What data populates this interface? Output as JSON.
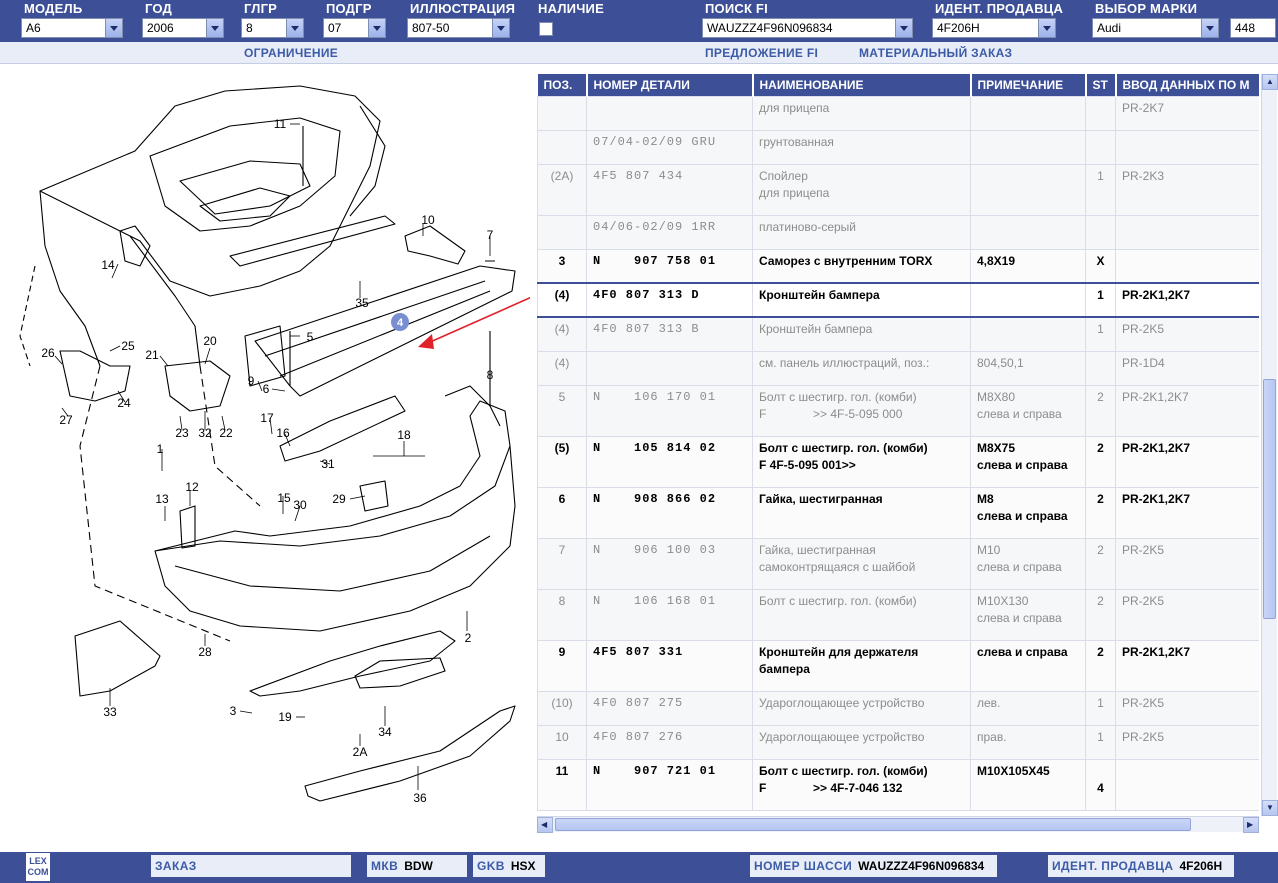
{
  "header": {
    "fields": [
      {
        "label": "МОДЕЛЬ",
        "value": "A6"
      },
      {
        "label": "ГОД",
        "value": "2006"
      },
      {
        "label": "ГЛГР",
        "value": "8"
      },
      {
        "label": "ПОДГР",
        "value": "07"
      },
      {
        "label": "ИЛЛЮСТРАЦИЯ",
        "value": "807-50"
      },
      {
        "label": "НАЛИЧИЕ",
        "value": ""
      },
      {
        "label": "ПОИСК FI",
        "value": "WAUZZZ4F96N096834"
      },
      {
        "label": "ИДЕНТ. ПРОДАВЦА",
        "value": "4F206H"
      },
      {
        "label": "ВЫБОР МАРКИ",
        "value": "Audi"
      }
    ],
    "extra_value": "448"
  },
  "subnav": {
    "restriction": "ОГРАНИЧЕНИЕ",
    "offer_fi": "ПРЕДЛОЖЕНИЕ FI",
    "material_order": "МАТЕРИАЛЬНЫЙ ЗАКАЗ"
  },
  "diagram": {
    "highlighted_callout": "4",
    "callouts": [
      "11",
      "10",
      "7",
      "14",
      "35",
      "5",
      "26",
      "25",
      "21",
      "20",
      "9",
      "6",
      "8",
      "24",
      "27",
      "23",
      "32",
      "22",
      "17",
      "16",
      "31",
      "18",
      "1",
      "12",
      "30",
      "13",
      "29",
      "15",
      "2",
      "28",
      "33",
      "3",
      "19",
      "34",
      "2A",
      "36"
    ]
  },
  "table": {
    "columns": [
      "ПОЗ.",
      "НОМЕР ДЕТАЛИ",
      "НАИМЕНОВАНИЕ",
      "ПРИМЕЧАНИЕ",
      "ST",
      "ВВОД ДАННЫХ ПО М"
    ],
    "rows": [
      {
        "style": "dim",
        "pos": "",
        "num": "",
        "name": "для прицепа",
        "note": "",
        "st": "",
        "data": "PR-2K7"
      },
      {
        "style": "dim",
        "pos": "",
        "num": "07/04-02/09 GRU",
        "name": "грунтованная",
        "note": "",
        "st": "",
        "data": ""
      },
      {
        "style": "dim",
        "pos": "(2A)",
        "num": "4F5 807 434",
        "name": "Спойлер\nдля прицепа",
        "note": "",
        "st": "1",
        "data": "PR-2K3"
      },
      {
        "style": "dim",
        "pos": "",
        "num": "04/06-02/09 1RR",
        "name": "платиново-серый",
        "note": "",
        "st": "",
        "data": ""
      },
      {
        "style": "bold",
        "pos": "3",
        "num": "N    907 758 01",
        "name": "Саморез с внутренним TORX",
        "note": "4,8X19",
        "st": "X",
        "data": ""
      },
      {
        "style": "bold sel-row",
        "pos": "(4)",
        "num": "4F0 807 313 D",
        "name": "Кронштейн бампера",
        "note": "",
        "st": "1",
        "data": "PR-2K1,2K7"
      },
      {
        "style": "dim",
        "pos": "(4)",
        "num": "4F0 807 313 B",
        "name": "Кронштейн бампера",
        "note": "",
        "st": "1",
        "data": "PR-2K5"
      },
      {
        "style": "dim",
        "pos": "(4)",
        "num": "",
        "name": "см. панель иллюстраций, поз.:",
        "note": "804,50,1",
        "st": "",
        "data": "PR-1D4"
      },
      {
        "style": "dim",
        "pos": "5",
        "num": "N    106 170 01",
        "name": "Болт с шестигр. гол. (комби)\nF              >> 4F-5-095 000",
        "note": "M8X80\nслева и справа",
        "st": "2",
        "data": "PR-2K1,2K7"
      },
      {
        "style": "bold",
        "pos": "(5)",
        "num": "N    105 814 02",
        "name": "Болт с шестигр. гол. (комби)\nF 4F-5-095 001>>",
        "note": "M8X75\nслева и справа",
        "st": "2",
        "data": "PR-2K1,2K7"
      },
      {
        "style": "bold",
        "pos": "6",
        "num": "N    908 866 02",
        "name": "Гайка, шестигранная",
        "note": "M8\nслева и справа",
        "st": "2",
        "data": "PR-2K1,2K7"
      },
      {
        "style": "dim",
        "pos": "7",
        "num": "N    906 100 03",
        "name": "Гайка, шестигранная\nсамоконтрящаяся с шайбой",
        "note": "M10\nслева и справа",
        "st": "2",
        "data": "PR-2K5"
      },
      {
        "style": "dim",
        "pos": "8",
        "num": "N    106 168 01",
        "name": "Болт с шестигр. гол. (комби)",
        "note": "M10X130\nслева и справа",
        "st": "2",
        "data": "PR-2K5"
      },
      {
        "style": "bold",
        "pos": "9",
        "num": "4F5 807 331",
        "name": "Кронштейн для держателя\nбампера",
        "note": "слева и справа",
        "st": "2",
        "data": "PR-2K1,2K7"
      },
      {
        "style": "dim",
        "pos": "(10)",
        "num": "4F0 807 275",
        "name": "Удароглощающее устройство",
        "note": "лев.",
        "st": "1",
        "data": "PR-2K5"
      },
      {
        "style": "dim",
        "pos": "10",
        "num": "4F0 807 276",
        "name": "Удароглощающее устройство",
        "note": "прав.",
        "st": "1",
        "data": "PR-2K5"
      },
      {
        "style": "bold",
        "pos": "11",
        "num": "N    907 721 01",
        "name": "Болт с шестигр. гол. (комби)\nF              >> 4F-7-046 132",
        "note": "M10X105X45",
        "st": "\n4",
        "data": ""
      }
    ]
  },
  "footer": {
    "logo": "LEX COM",
    "order": "ЗАКАЗ",
    "mkb_label": "МКВ",
    "mkb_value": "BDW",
    "gkb_label": "GKB",
    "gkb_value": "HSX",
    "chassis_label": "НОМЕР ШАССИ",
    "chassis_value": "WAUZZZ4F96N096834",
    "dealer_label": "ИДЕНТ. ПРОДАВЦА",
    "dealer_value": "4F206H"
  },
  "colors": {
    "bar": "#3c4f97",
    "link": "#3c5ba7",
    "highlight_callout": "#7a8fd0",
    "arrow": "#e0202a"
  }
}
